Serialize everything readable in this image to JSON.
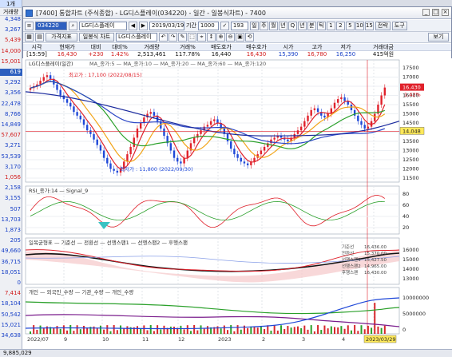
{
  "left_panel": {
    "header": "거래량",
    "tab_label": "1개",
    "items": [
      {
        "value": "4,348",
        "color": "#1840c7"
      },
      {
        "value": "3,267",
        "color": "#1840c7"
      },
      {
        "value": "5,439",
        "color": "#d21b1b"
      },
      {
        "value": "14,000",
        "color": "#d21b1b"
      },
      {
        "value": "15,001",
        "color": "#d21b1b"
      },
      {
        "value": "619",
        "color": "#ffffff",
        "highlight": true
      },
      {
        "value": "3,292",
        "color": "#1840c7"
      },
      {
        "value": "3,356",
        "color": "#1840c7"
      },
      {
        "value": "22,478",
        "color": "#1840c7"
      },
      {
        "value": "8,766",
        "color": "#1840c7"
      },
      {
        "value": "14,849",
        "color": "#1840c7"
      },
      {
        "value": "57,607",
        "color": "#d21b1b"
      },
      {
        "value": "3,271",
        "color": "#1840c7"
      },
      {
        "value": "53,539",
        "color": "#1840c7"
      },
      {
        "value": "3,170",
        "color": "#1840c7"
      },
      {
        "value": "1,056",
        "color": "#d21b1b"
      },
      {
        "value": "2,158",
        "color": "#1840c7"
      },
      {
        "value": "3,155",
        "color": "#1840c7"
      },
      {
        "value": "507",
        "color": "#1840c7"
      },
      {
        "value": "13,703",
        "color": "#1840c7"
      },
      {
        "value": "1,873",
        "color": "#1840c7"
      },
      {
        "value": "205",
        "color": "#1840c7"
      },
      {
        "value": "49,660",
        "color": "#1840c7"
      },
      {
        "value": "36,715",
        "color": "#1840c7"
      },
      {
        "value": "18,051",
        "color": "#1840c7"
      },
      {
        "value": "0",
        "color": "#1840c7"
      },
      {
        "value": "7,414",
        "color": "#d21b1b"
      },
      {
        "value": "18,104",
        "color": "#1840c7"
      },
      {
        "value": "50,542",
        "color": "#1840c7"
      },
      {
        "value": "15,021",
        "color": "#1840c7"
      },
      {
        "value": "34,638",
        "color": "#1840c7"
      }
    ]
  },
  "window": {
    "title": "[7400] 통합차트 (주식종합) - LG디스플레이(034220) - 일간 - 일봉식차트) - 7400"
  },
  "toolbar": {
    "code": "034220",
    "name": "LG디스플레이",
    "date": "2019/03/19",
    "period_label": "기간",
    "period_value": "1000",
    "count_value": "193",
    "units": [
      "일",
      "주",
      "월",
      "년",
      "Q",
      "년",
      "분",
      "틱",
      "1",
      "2",
      "5",
      "10",
      "15"
    ],
    "right_buttons": [
      "전략",
      "도구",
      "보기"
    ],
    "row2": [
      "가격지표",
      "일봉식 차트",
      "LG디스플레이"
    ]
  },
  "quote": {
    "headers": [
      "시각",
      "현재가",
      "대비",
      "대비%",
      "거래량",
      "거래%",
      "매도호가",
      "매수호가",
      "시가",
      "고가",
      "저가",
      "거래대금"
    ],
    "values": [
      "[15:59]",
      "16,430",
      "+230",
      "1.42%",
      "2,513,461",
      "117.78%",
      "16,440",
      "16,430",
      "15,390",
      "16,780",
      "16,250",
      "415억원"
    ]
  },
  "panels": {
    "price_title": "LG디스플레이(일간)",
    "ma_legend": "MA_종가:5 — MA_종가:10 — MA_종가:20 — MA_종가:60 — MA_종가:120",
    "high_label": "최고가 : 17,100 (2022/08/15)",
    "low_label": "최저가 : 11,800 (2022/09/30)",
    "price_ticks": [
      "17500",
      "17000",
      "16500",
      "16000",
      "15500",
      "15000",
      "14500",
      "14000",
      "13500",
      "13000",
      "12500",
      "12000",
      "11500"
    ],
    "crosshair_value": "14,048",
    "last_price": "16,430",
    "last_pct": "1.42%",
    "rsi_title": "RSI_종가:14 — Signal_9",
    "rsi_ticks": [
      "80",
      "60",
      "40",
      "20"
    ],
    "ichimoku_title": "일목균형표 — 기준선 — 전환선 — 선행스팬1 — 선행스팬2 — 후행스팬",
    "ichimoku_ticks": [
      "16000",
      "15000",
      "14000",
      "13000"
    ],
    "ichimoku_values": [
      "16,436.00",
      "15,370.00",
      "15,427.50",
      "14,965.00",
      "16,430.00"
    ],
    "ichimoku_labels": [
      "기준선",
      "전환선",
      "선행스팬1",
      "선행스팬2",
      "후행스팬"
    ],
    "flow_title": "개인 — 외국인_수량 — 기관_수량 — 개인_수량",
    "flow_ticks": [
      "10000000",
      "5000000",
      "0"
    ],
    "xaxis": [
      "2022/07",
      "9",
      "10",
      "11",
      "12",
      "2023",
      "2",
      "3",
      "4",
      "5"
    ],
    "cursor_date": "2023/03/29"
  },
  "status": {
    "text": "9,885,029"
  }
}
